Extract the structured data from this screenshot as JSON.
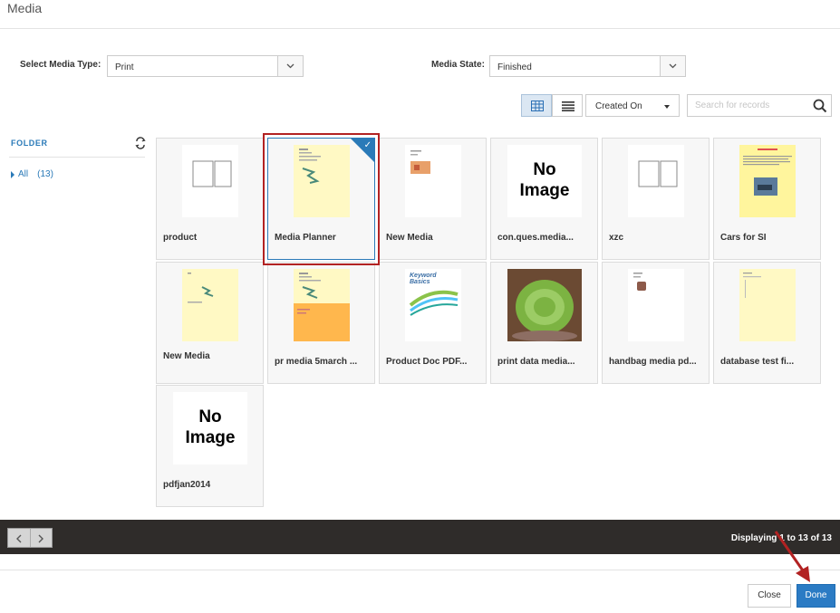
{
  "dialog": {
    "title": "Media"
  },
  "filters": {
    "media_type_label": "Select Media Type:",
    "media_type_value": "Print",
    "media_state_label": "Media State:",
    "media_state_value": "Finished"
  },
  "toolbar": {
    "sort_value": "Created On",
    "search_placeholder": "Search for records"
  },
  "folder": {
    "header": "FOLDER",
    "item_label": "All",
    "item_count": "(13)"
  },
  "tiles": [
    {
      "name": "product",
      "thumb": "layout-blank"
    },
    {
      "name": "Media Planner",
      "thumb": "yellow-doc",
      "selected": true
    },
    {
      "name": "New Media",
      "thumb": "white-doc"
    },
    {
      "name": "con.ques.media...",
      "thumb": "no-image"
    },
    {
      "name": "xzc",
      "thumb": "layout-blank"
    },
    {
      "name": "Cars for SI",
      "thumb": "yellow-car"
    },
    {
      "name": "New Media",
      "thumb": "yellow-doc"
    },
    {
      "name": "pr media 5march ...",
      "thumb": "yellow-orange"
    },
    {
      "name": "Product Doc PDF...",
      "thumb": "keyword"
    },
    {
      "name": "print data media...",
      "thumb": "photo"
    },
    {
      "name": "handbag media pd...",
      "thumb": "white-bag"
    },
    {
      "name": "database test fi...",
      "thumb": "yellow-plain"
    },
    {
      "name": "pdfjan2014",
      "thumb": "no-image"
    }
  ],
  "no_image": {
    "line1": "No",
    "line2": "Image"
  },
  "thumb_text": {
    "keyword_line1": "Keyword",
    "keyword_line2": "Basics"
  },
  "pager": {
    "display_text": "Displaying 1 to 13 of 13"
  },
  "footer": {
    "close_label": "Close",
    "done_label": "Done"
  },
  "colors": {
    "accent": "#2b7bc4",
    "annotation": "#b22222",
    "pager_bg": "#2f2c2a"
  }
}
